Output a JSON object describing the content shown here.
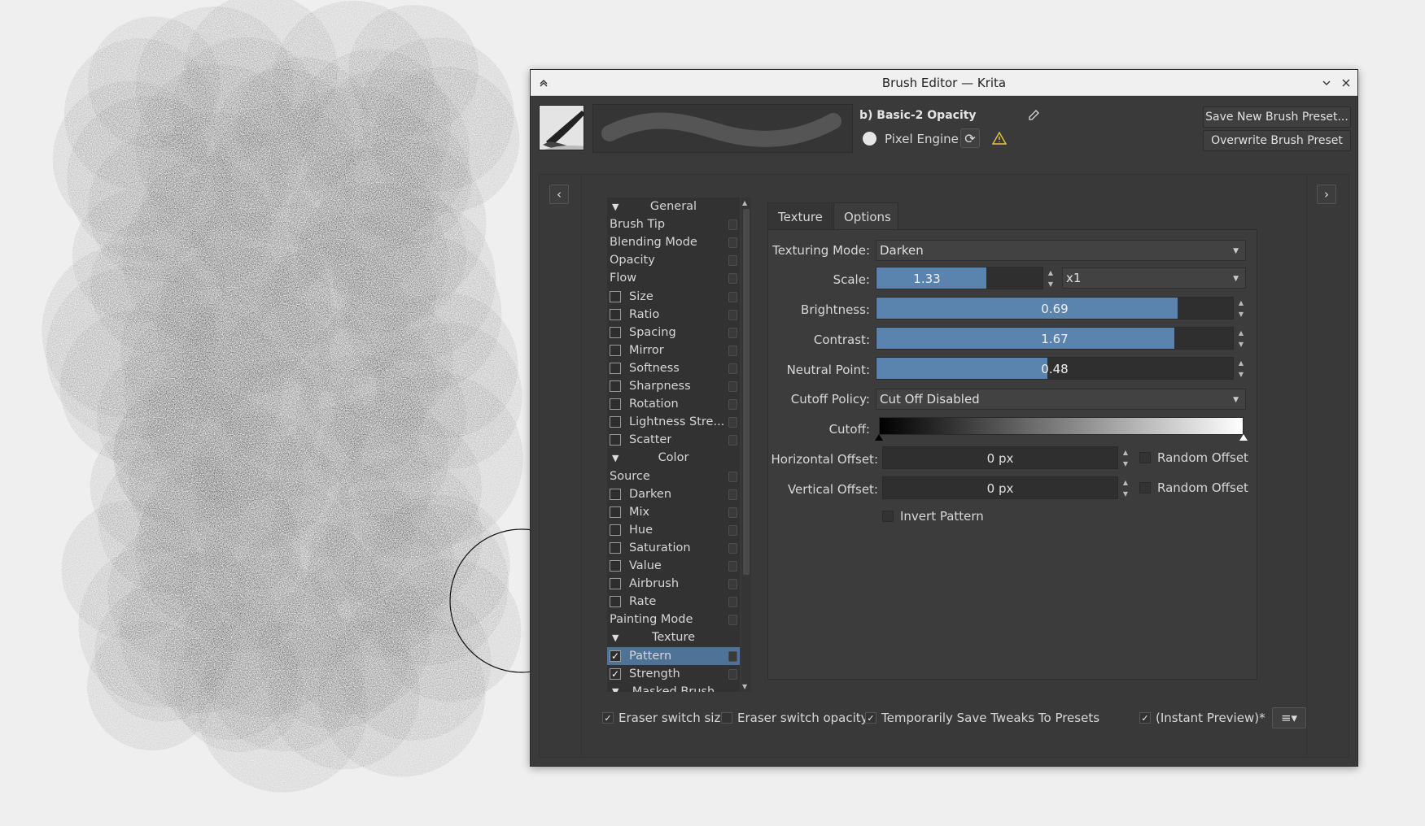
{
  "window": {
    "title": "Brush Editor — Krita"
  },
  "header": {
    "preset_name": "b) Basic-2 Opacity",
    "engine_label": "Pixel Engine",
    "save_new_label": "Save New Brush Preset...",
    "overwrite_label": "Overwrite Brush Preset"
  },
  "options_list": [
    {
      "type": "header",
      "label": "General"
    },
    {
      "type": "item",
      "label": "Brush Tip"
    },
    {
      "type": "item",
      "label": "Blending Mode"
    },
    {
      "type": "item",
      "label": "Opacity"
    },
    {
      "type": "item",
      "label": "Flow"
    },
    {
      "type": "check",
      "label": "Size",
      "checked": false
    },
    {
      "type": "check",
      "label": "Ratio",
      "checked": false
    },
    {
      "type": "check",
      "label": "Spacing",
      "checked": false
    },
    {
      "type": "check",
      "label": "Mirror",
      "checked": false
    },
    {
      "type": "check",
      "label": "Softness",
      "checked": false
    },
    {
      "type": "check",
      "label": "Sharpness",
      "checked": false
    },
    {
      "type": "check",
      "label": "Rotation",
      "checked": false
    },
    {
      "type": "check",
      "label": "Lightness Stre...",
      "checked": false
    },
    {
      "type": "check",
      "label": "Scatter",
      "checked": false
    },
    {
      "type": "header",
      "label": "Color"
    },
    {
      "type": "item",
      "label": "Source"
    },
    {
      "type": "check",
      "label": "Darken",
      "checked": false
    },
    {
      "type": "check",
      "label": "Mix",
      "checked": false
    },
    {
      "type": "check",
      "label": "Hue",
      "checked": false
    },
    {
      "type": "check",
      "label": "Saturation",
      "checked": false
    },
    {
      "type": "check",
      "label": "Value",
      "checked": false
    },
    {
      "type": "check",
      "label": "Airbrush",
      "checked": false
    },
    {
      "type": "check",
      "label": "Rate",
      "checked": false
    },
    {
      "type": "item",
      "label": "Painting Mode"
    },
    {
      "type": "header",
      "label": "Texture"
    },
    {
      "type": "check",
      "label": "Pattern",
      "checked": true,
      "selected": true
    },
    {
      "type": "check",
      "label": "Strength",
      "checked": true
    },
    {
      "type": "header",
      "label": "Masked Brush"
    }
  ],
  "tabs": {
    "texture": "Texture",
    "options": "Options"
  },
  "settings": {
    "texturing_mode_label": "Texturing Mode:",
    "texturing_mode_value": "Darken",
    "scale_label": "Scale:",
    "scale_value": "1.33",
    "scale_fill": 0.66,
    "scale_multiplier": "x1",
    "brightness_label": "Brightness:",
    "brightness_value": "0.69",
    "brightness_fill": 0.845,
    "contrast_label": "Contrast:",
    "contrast_value": "1.67",
    "contrast_fill": 0.835,
    "neutral_label": "Neutral Point:",
    "neutral_value": "0.48",
    "neutral_fill": 0.48,
    "cutoff_policy_label": "Cutoff Policy:",
    "cutoff_policy_value": "Cut Off Disabled",
    "cutoff_label": "Cutoff:",
    "h_offset_label": "Horizontal Offset:",
    "h_offset_value": "0 px",
    "v_offset_label": "Vertical Offset:",
    "v_offset_value": "0 px",
    "random_offset_label": "Random Offset",
    "invert_pattern_label": "Invert Pattern"
  },
  "footer": {
    "eraser_size": {
      "label": "Eraser switch size",
      "checked": true
    },
    "eraser_opacity": {
      "label": "Eraser switch opacity",
      "checked": false
    },
    "save_tweaks": {
      "label": "Temporarily Save Tweaks To Presets",
      "checked": true
    },
    "instant_preview": {
      "label": "(Instant Preview)*",
      "checked": true
    }
  },
  "colors": {
    "accent": "#5a84ad",
    "selected": "#4f7396",
    "window_bg": "#3a3a3a"
  }
}
